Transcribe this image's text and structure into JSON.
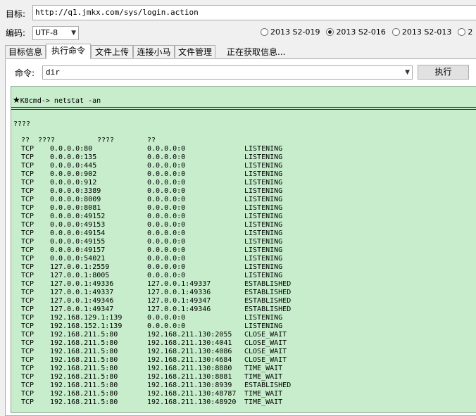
{
  "target": {
    "label": "目标:",
    "url": "http://q1.jmkx.com/sys/login.action"
  },
  "encoding": {
    "label": "编码:",
    "value": "UTF-8"
  },
  "versions": [
    {
      "label": "2013 S2-019",
      "selected": false
    },
    {
      "label": "2013 S2-016",
      "selected": true
    },
    {
      "label": "2013 S2-013",
      "selected": false
    },
    {
      "label": "2",
      "selected": false
    }
  ],
  "tabs": [
    {
      "label": "目标信息",
      "active": false
    },
    {
      "label": "执行命令",
      "active": true
    },
    {
      "label": "文件上传",
      "active": false
    },
    {
      "label": "连接小马",
      "active": false
    },
    {
      "label": "文件管理",
      "active": false
    }
  ],
  "status": "正在获取信息...",
  "command": {
    "label": "命令:",
    "value": "dir",
    "execute_label": "执行"
  },
  "output": {
    "prompt_star": "★",
    "prompt": "K8cmd-> netstat -an",
    "line1": "????",
    "headers": {
      "h1": "??",
      "h2": "????",
      "h3": "????",
      "h4": "??"
    },
    "rows": [
      [
        "TCP",
        "0.0.0.0:80",
        "0.0.0.0:0",
        "LISTENING"
      ],
      [
        "TCP",
        "0.0.0.0:135",
        "0.0.0.0:0",
        "LISTENING"
      ],
      [
        "TCP",
        "0.0.0.0:445",
        "0.0.0.0:0",
        "LISTENING"
      ],
      [
        "TCP",
        "0.0.0.0:902",
        "0.0.0.0:0",
        "LISTENING"
      ],
      [
        "TCP",
        "0.0.0.0:912",
        "0.0.0.0:0",
        "LISTENING"
      ],
      [
        "TCP",
        "0.0.0.0:3389",
        "0.0.0.0:0",
        "LISTENING"
      ],
      [
        "TCP",
        "0.0.0.0:8009",
        "0.0.0.0:0",
        "LISTENING"
      ],
      [
        "TCP",
        "0.0.0.0:8081",
        "0.0.0.0:0",
        "LISTENING"
      ],
      [
        "TCP",
        "0.0.0.0:49152",
        "0.0.0.0:0",
        "LISTENING"
      ],
      [
        "TCP",
        "0.0.0.0:49153",
        "0.0.0.0:0",
        "LISTENING"
      ],
      [
        "TCP",
        "0.0.0.0:49154",
        "0.0.0.0:0",
        "LISTENING"
      ],
      [
        "TCP",
        "0.0.0.0:49155",
        "0.0.0.0:0",
        "LISTENING"
      ],
      [
        "TCP",
        "0.0.0.0:49157",
        "0.0.0.0:0",
        "LISTENING"
      ],
      [
        "TCP",
        "0.0.0.0:54021",
        "0.0.0.0:0",
        "LISTENING"
      ],
      [
        "TCP",
        "127.0.0.1:2559",
        "0.0.0.0:0",
        "LISTENING"
      ],
      [
        "TCP",
        "127.0.0.1:8005",
        "0.0.0.0:0",
        "LISTENING"
      ],
      [
        "TCP",
        "127.0.0.1:49336",
        "127.0.0.1:49337",
        "ESTABLISHED"
      ],
      [
        "TCP",
        "127.0.0.1:49337",
        "127.0.0.1:49336",
        "ESTABLISHED"
      ],
      [
        "TCP",
        "127.0.0.1:49346",
        "127.0.0.1:49347",
        "ESTABLISHED"
      ],
      [
        "TCP",
        "127.0.0.1:49347",
        "127.0.0.1:49346",
        "ESTABLISHED"
      ],
      [
        "TCP",
        "192.168.129.1:139",
        "0.0.0.0:0",
        "LISTENING"
      ],
      [
        "TCP",
        "192.168.152.1:139",
        "0.0.0.0:0",
        "LISTENING"
      ],
      [
        "TCP",
        "192.168.211.5:80",
        "192.168.211.130:2055",
        "CLOSE_WAIT"
      ],
      [
        "TCP",
        "192.168.211.5:80",
        "192.168.211.130:4041",
        "CLOSE_WAIT"
      ],
      [
        "TCP",
        "192.168.211.5:80",
        "192.168.211.130:4086",
        "CLOSE_WAIT"
      ],
      [
        "TCP",
        "192.168.211.5:80",
        "192.168.211.130:4684",
        "CLOSE_WAIT"
      ],
      [
        "TCP",
        "192.168.211.5:80",
        "192.168.211.130:8880",
        "TIME_WAIT"
      ],
      [
        "TCP",
        "192.168.211.5:80",
        "192.168.211.130:8881",
        "TIME_WAIT"
      ],
      [
        "TCP",
        "192.168.211.5:80",
        "192.168.211.130:8939",
        "ESTABLISHED"
      ],
      [
        "TCP",
        "192.168.211.5:80",
        "192.168.211.130:48787",
        "TIME_WAIT"
      ],
      [
        "TCP",
        "192.168.211.5:80",
        "192.168.211.130:48920",
        "TIME_WAIT"
      ]
    ]
  }
}
